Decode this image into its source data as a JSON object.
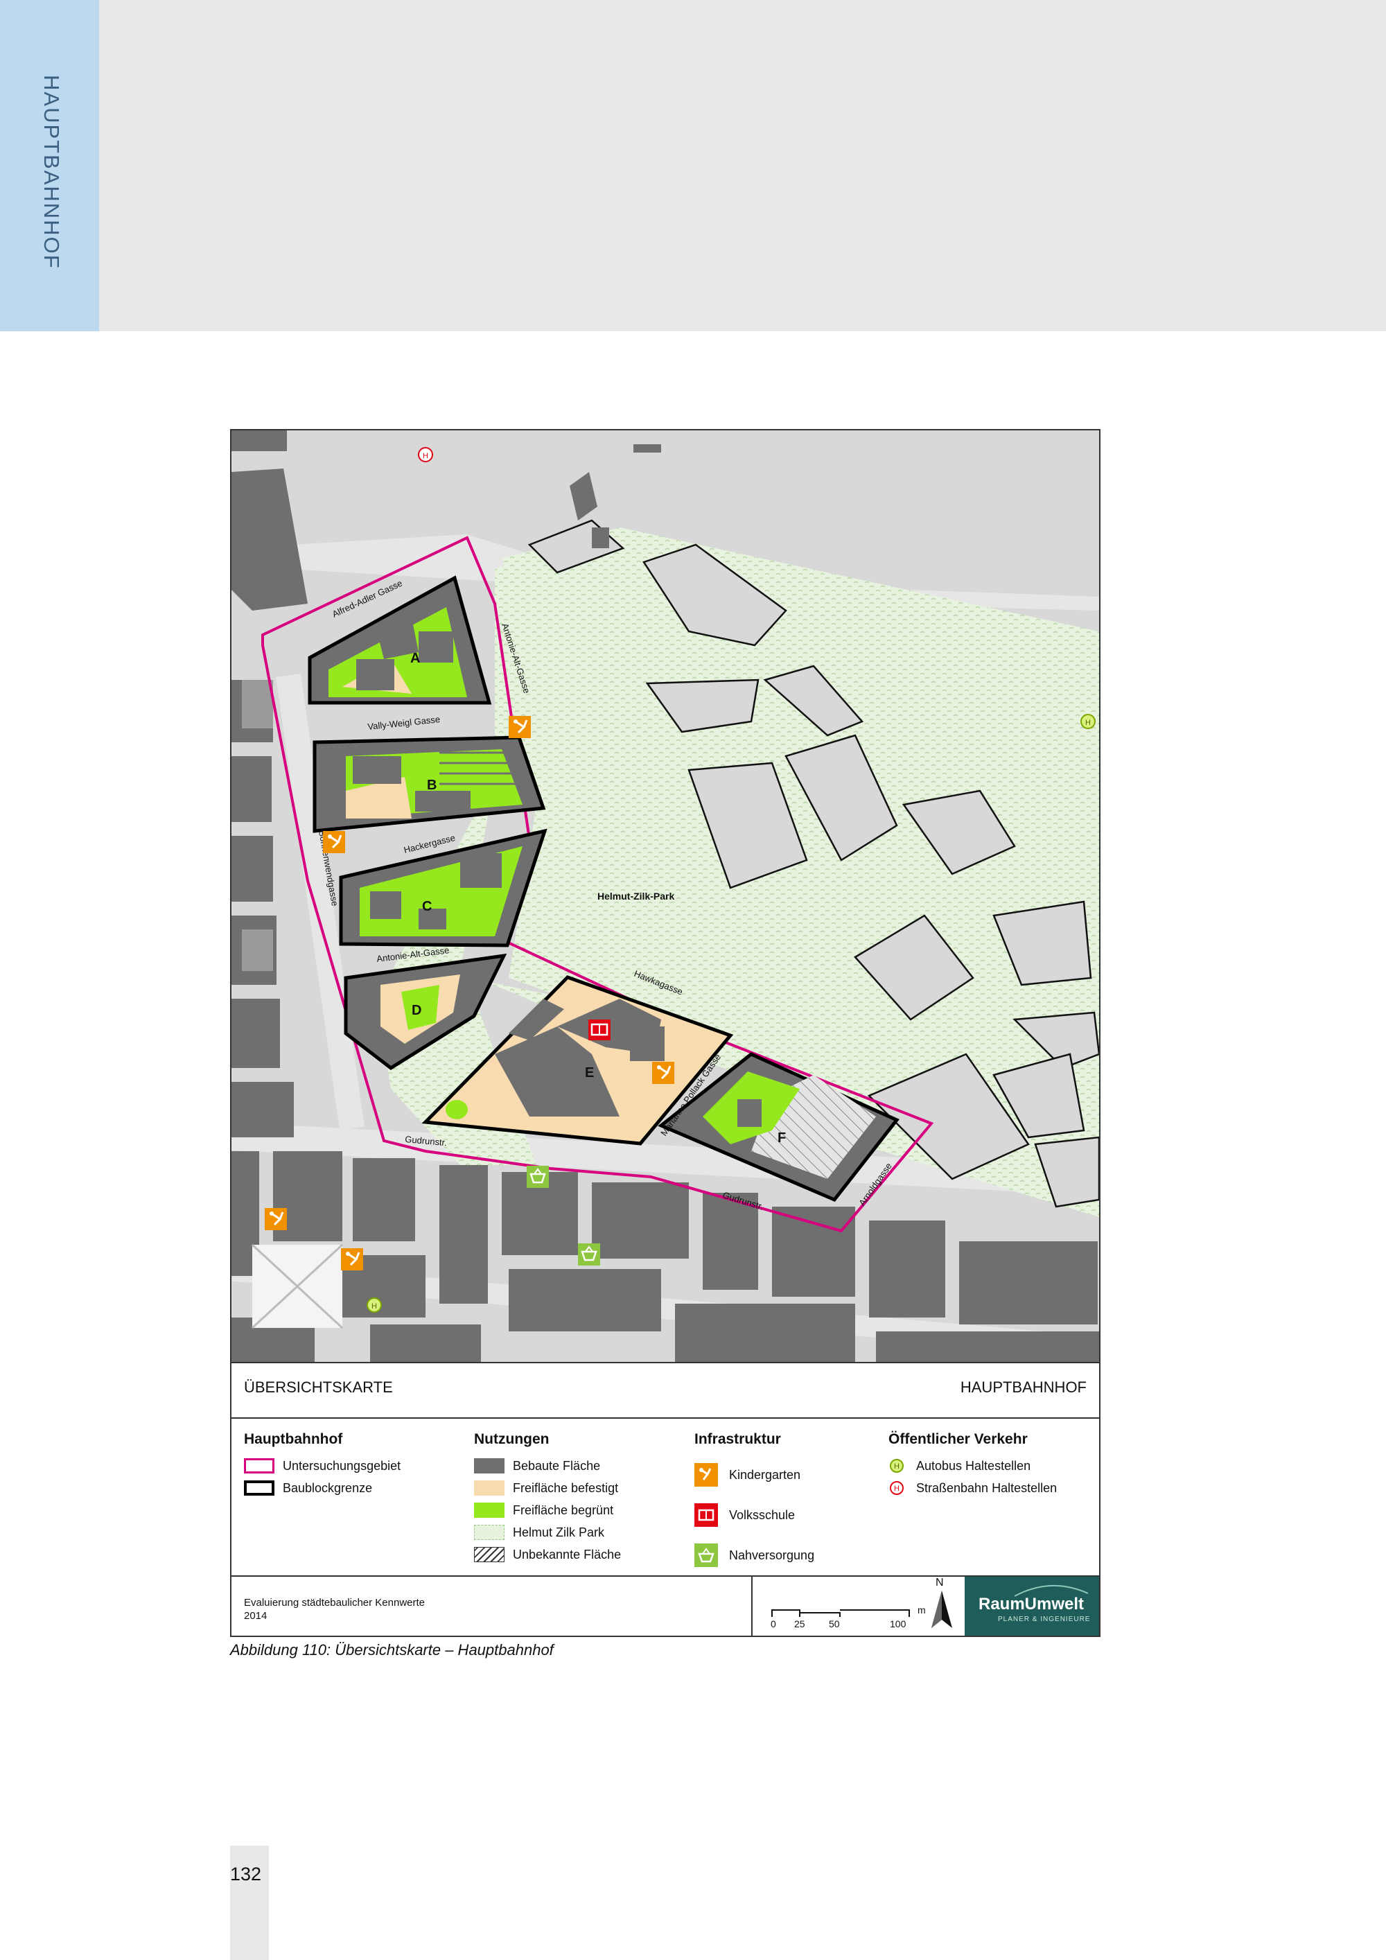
{
  "side_tab": {
    "label": "HAUPTBAHNHOF"
  },
  "map": {
    "park_label": "Helmut-Zilk-Park",
    "block_labels": [
      "A",
      "B",
      "C",
      "D",
      "E",
      "F"
    ],
    "streets": {
      "alfred_adler": "Alfred-Adler Gasse",
      "antonie_alt_top": "Antonie-Alt-Gasse",
      "vally_weigl": "Vally-Weigl Gasse",
      "hackergasse": "Hackergasse",
      "sonnenwendgasse": "Sonnenwendgasse",
      "antonie_alt_mid": "Antonie-Alt-Gasse",
      "hawkagasse": "Hawkagasse",
      "marianne_pollak": "Marianne Pollack Gasse",
      "gudrunstr_left": "Gudrunstr.",
      "gudrunstr_right": "Gudrunstr.",
      "arnoldgasse": "Arnoldgasse"
    },
    "colors": {
      "built": "#6f6f6f",
      "paved": "#f8dcb0",
      "green": "#96e81e",
      "park": "#e7f2df",
      "boundary": "#d6007f",
      "block": "#000000",
      "kindergarten": "#f29100",
      "school": "#e30613",
      "supply": "#8dc63f"
    }
  },
  "title_bar": {
    "left": "ÜBERSICHTSKARTE",
    "right": "HAUPTBAHNHOF"
  },
  "legend": {
    "hauptbahnhof": {
      "heading": "Hauptbahnhof",
      "items": [
        "Untersuchungsgebiet",
        "Baublockgrenze"
      ]
    },
    "nutzungen": {
      "heading": "Nutzungen",
      "items": [
        "Bebaute Fläche",
        "Freifläche befestigt",
        "Freifläche begrünt",
        "Helmut Zilk Park",
        "Unbekannte Fläche"
      ]
    },
    "infrastruktur": {
      "heading": "Infrastruktur",
      "items": [
        "Kindergarten",
        "Volksschule",
        "Nahversorgung"
      ]
    },
    "verkehr": {
      "heading": "Öffentlicher Verkehr",
      "items": [
        "Autobus Haltestellen",
        "Straßenbahn Haltestellen"
      ]
    }
  },
  "footer": {
    "line1": "Evaluierung städtebaulicher Kennwerte",
    "line2": "2014",
    "scale_ticks": [
      "0",
      "25",
      "50",
      "100"
    ],
    "scale_unit": "m",
    "north": "N",
    "logo": "RaumUmwelt",
    "logo_sub": "PLANER & INGENIEURE"
  },
  "caption": "Abbildung 110: Übersichtskarte – Hauptbahnhof",
  "page_number": "132"
}
